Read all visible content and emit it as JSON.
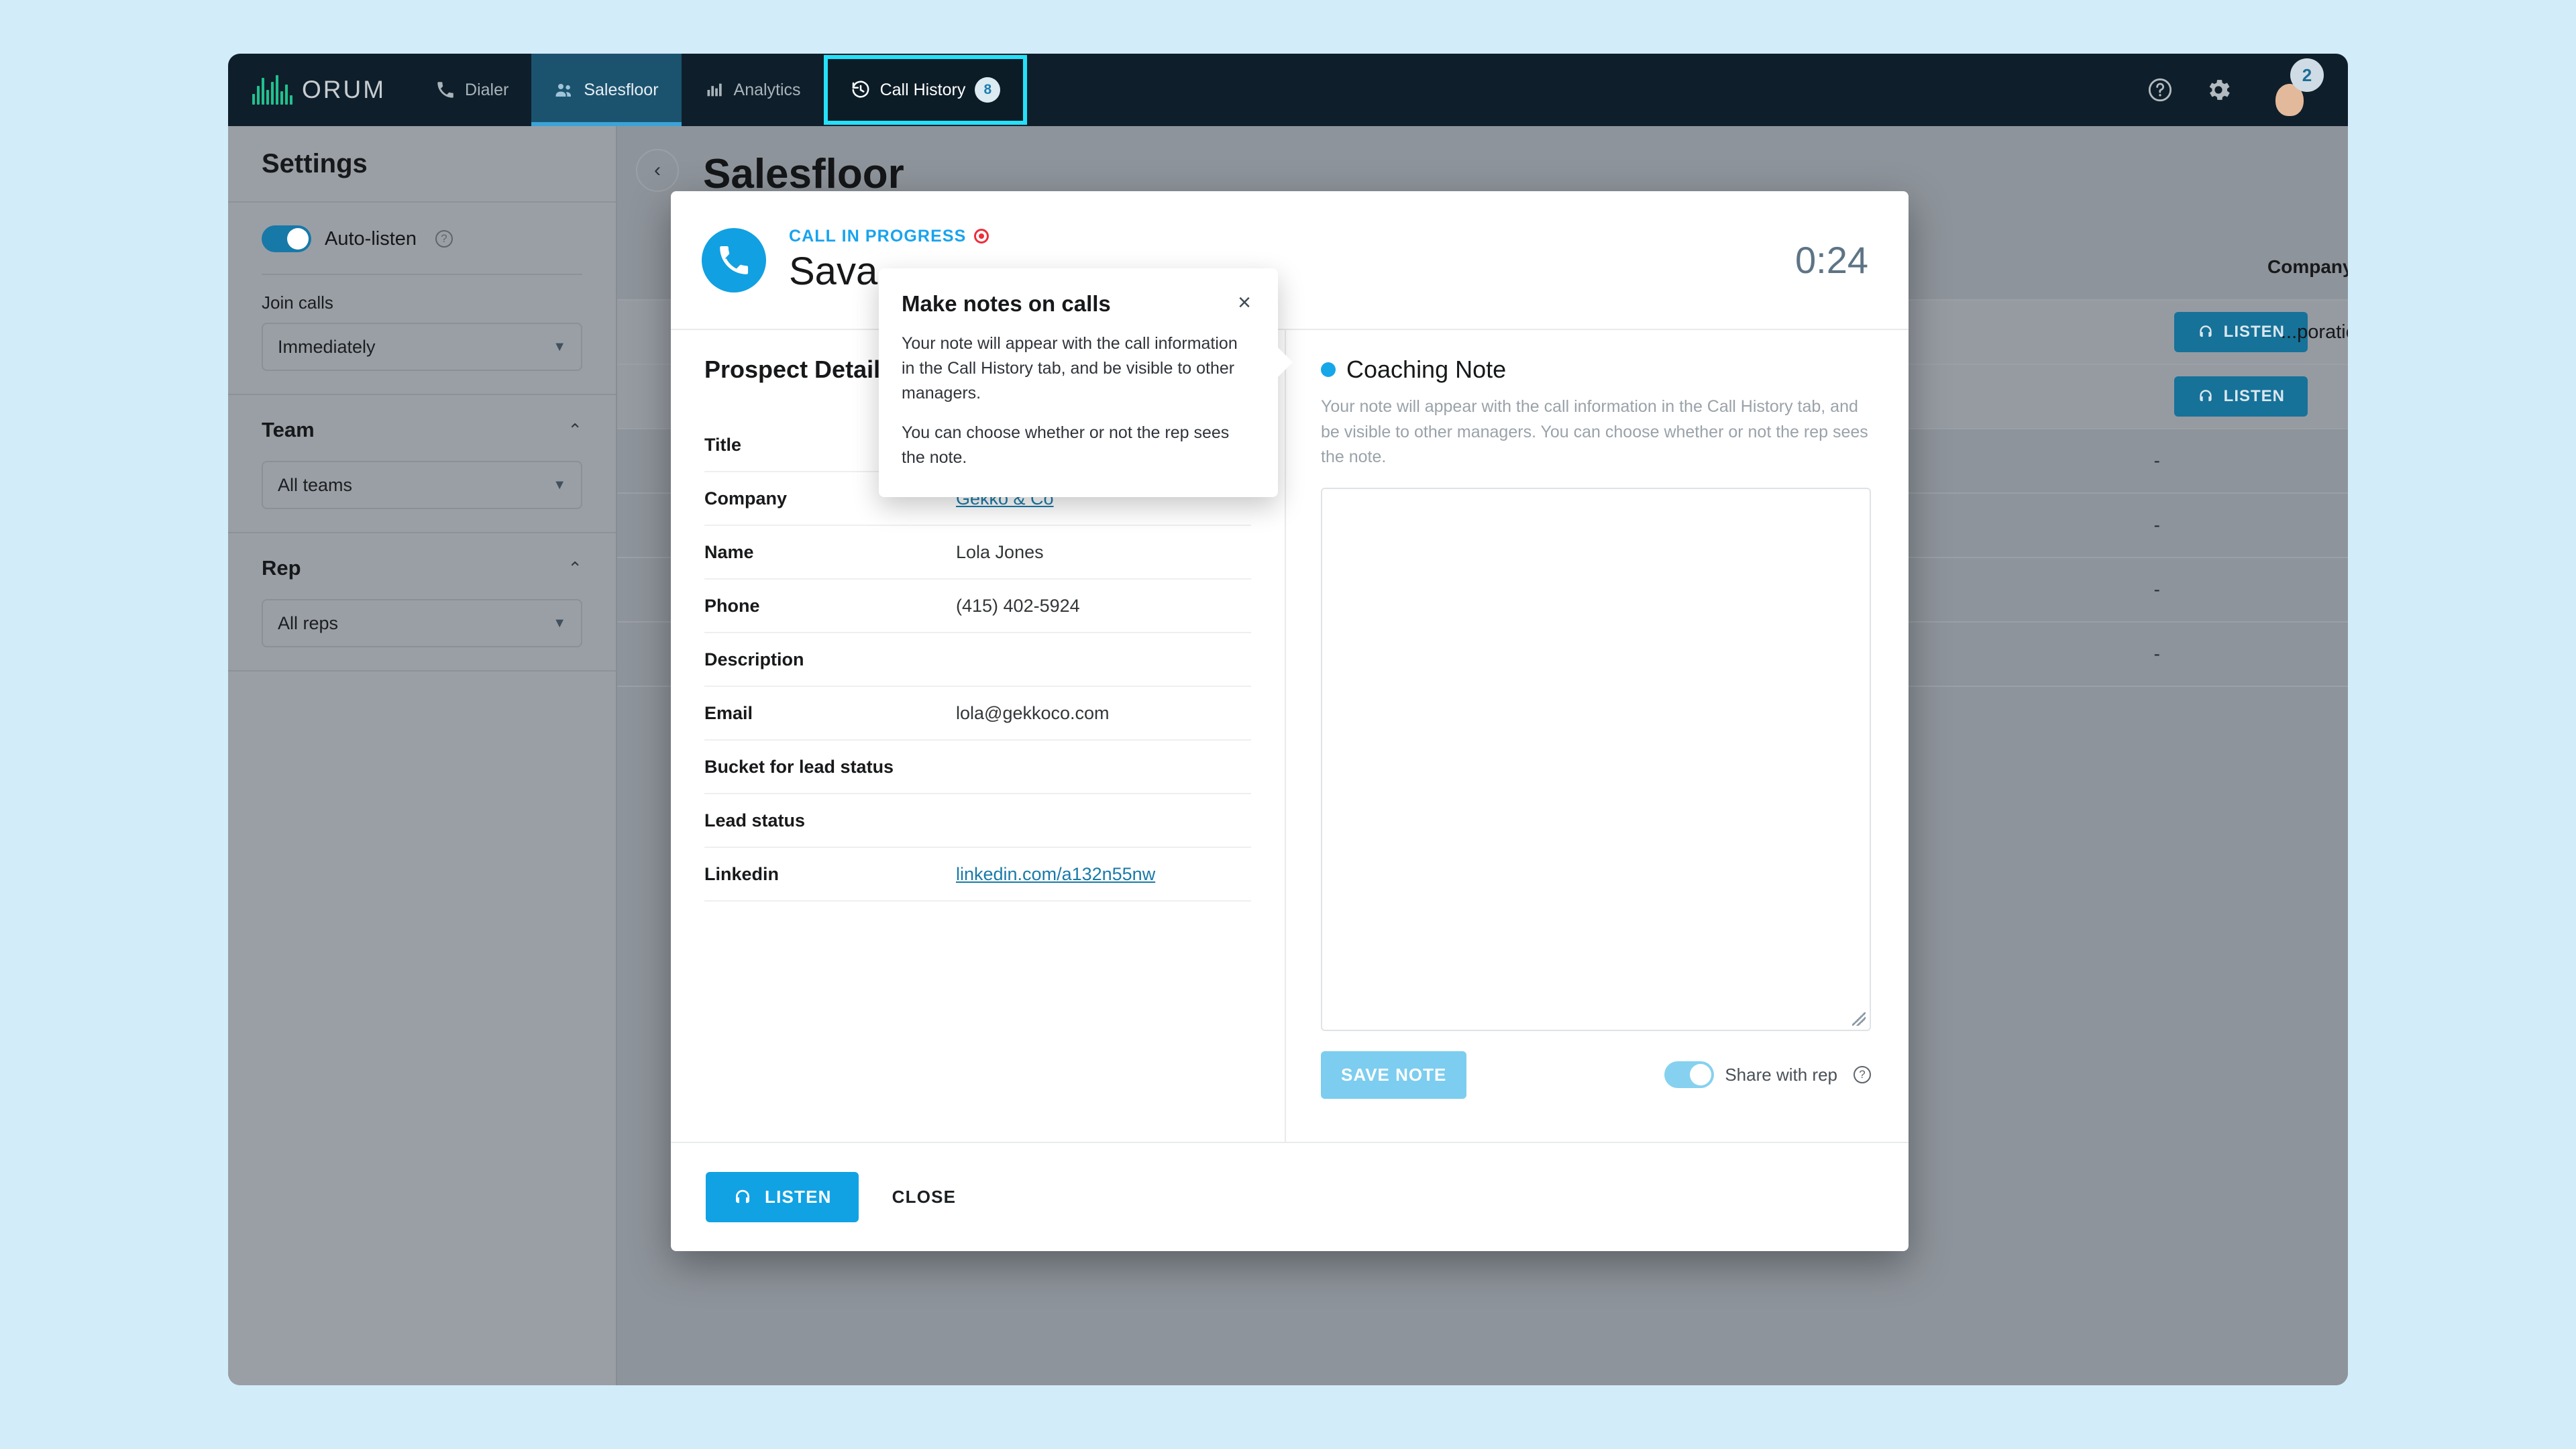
{
  "nav": {
    "brand": "ORUM",
    "tabs": [
      {
        "label": "Dialer",
        "icon": "phone-icon"
      },
      {
        "label": "Salesfloor",
        "icon": "people-icon"
      },
      {
        "label": "Analytics",
        "icon": "bar-chart-icon"
      },
      {
        "label": "Call History",
        "icon": "history-icon",
        "badge": "8"
      }
    ],
    "help_icon": "help-circle-icon",
    "settings_icon": "gear-icon",
    "avatar_badge": "2"
  },
  "settings": {
    "title": "Settings",
    "auto_listen_label": "Auto-listen",
    "auto_listen_on": true,
    "join_calls_label": "Join calls",
    "join_calls_value": "Immediately",
    "team_label": "Team",
    "team_value": "All teams",
    "rep_label": "Rep",
    "rep_value": "All reps"
  },
  "page": {
    "title": "Salesfloor",
    "column_header": "Company",
    "rows": [
      {
        "company": "...poration",
        "action": "LISTEN"
      },
      {
        "company": "",
        "action": "LISTEN"
      },
      {
        "company": "",
        "action": "-"
      },
      {
        "company": "",
        "action": "-"
      },
      {
        "company": "",
        "action": "-"
      },
      {
        "company": "",
        "action": "-"
      }
    ]
  },
  "modal": {
    "status": "CALL IN PROGRESS",
    "name": "Sava",
    "timer": "0:24",
    "details_title": "Prospect Details",
    "details": [
      {
        "key": "Title",
        "value": ""
      },
      {
        "key": "Company",
        "value": "Gekko & Co",
        "link": true
      },
      {
        "key": "Name",
        "value": "Lola Jones"
      },
      {
        "key": "Phone",
        "value": "(415) 402-5924"
      },
      {
        "key": "Description",
        "value": ""
      },
      {
        "key": "Email",
        "value": "lola@gekkoco.com"
      },
      {
        "key": "Bucket for lead status",
        "value": ""
      },
      {
        "key": "Lead status",
        "value": ""
      },
      {
        "key": "Linkedin",
        "value": "linkedin.com/a132n55nw",
        "link": true
      }
    ],
    "coaching": {
      "title": "Coaching Note",
      "description": "Your note will appear with the call information in the Call History tab, and be visible to other managers. You can choose whether or not the rep sees the note.",
      "note_value": "",
      "save_label": "SAVE NOTE",
      "share_label": "Share with rep",
      "share_on": true
    },
    "footer": {
      "listen_label": "LISTEN",
      "close_label": "CLOSE"
    }
  },
  "tooltip": {
    "title": "Make notes on calls",
    "paragraph1": "Your note will appear with the call information in the Call History tab, and be visible to other managers.",
    "paragraph2": "You can choose whether or not the rep sees the note.",
    "close_icon": "close-icon"
  },
  "colors": {
    "page_bg": "#d3ecf9",
    "nav_bg": "#0e1f2b",
    "accent_blue": "#11a2e4",
    "highlight_cyan": "#25e0f8",
    "brand_green": "#22c08e",
    "record_red": "#ee2d3c"
  }
}
